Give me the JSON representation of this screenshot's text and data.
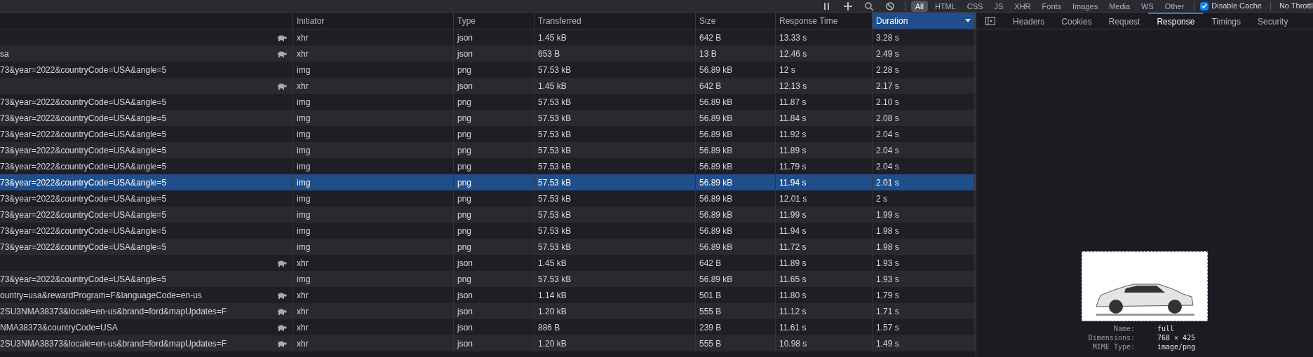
{
  "toolbar": {
    "filters": [
      {
        "label": "All",
        "selected": true
      },
      {
        "label": "HTML",
        "selected": false
      },
      {
        "label": "CSS",
        "selected": false
      },
      {
        "label": "JS",
        "selected": false
      },
      {
        "label": "XHR",
        "selected": false
      },
      {
        "label": "Fonts",
        "selected": false
      },
      {
        "label": "Images",
        "selected": false
      },
      {
        "label": "Media",
        "selected": false
      },
      {
        "label": "WS",
        "selected": false
      },
      {
        "label": "Other",
        "selected": false
      }
    ],
    "disable_cache": {
      "label": "Disable Cache",
      "checked": true
    },
    "throttling": "No Throttl"
  },
  "table": {
    "columns": [
      {
        "sorted": false
      },
      {
        "label": "Initiator",
        "sorted": false
      },
      {
        "label": "Type",
        "sorted": false
      },
      {
        "label": "Transferred",
        "sorted": false
      },
      {
        "label": "Size",
        "sorted": false
      },
      {
        "label": "Response Time",
        "sorted": false
      },
      {
        "label": "Duration",
        "sorted": true
      }
    ],
    "rows": [
      {
        "slow": true,
        "initiator": "xhr",
        "type": "json",
        "transferred": "1.45 kB",
        "size": "642 B",
        "response_time": "13.33 s",
        "duration": "3.28 s",
        "selected": false
      },
      {
        "name": "sa",
        "slow": true,
        "initiator": "xhr",
        "type": "json",
        "transferred": "653 B",
        "size": "13 B",
        "response_time": "12.46 s",
        "duration": "2.49 s",
        "selected": false
      },
      {
        "name": "73&year=2022&countryCode=USA&angle=5",
        "slow": false,
        "initiator": "img",
        "type": "png",
        "transferred": "57.53 kB",
        "size": "56.89 kB",
        "response_time": "12 s",
        "duration": "2.28 s",
        "selected": false
      },
      {
        "slow": true,
        "initiator": "xhr",
        "type": "json",
        "transferred": "1.45 kB",
        "size": "642 B",
        "response_time": "12.13 s",
        "duration": "2.17 s",
        "selected": false
      },
      {
        "name": "73&year=2022&countryCode=USA&angle=5",
        "slow": false,
        "initiator": "img",
        "type": "png",
        "transferred": "57.53 kB",
        "size": "56.89 kB",
        "response_time": "11.87 s",
        "duration": "2.10 s",
        "selected": false
      },
      {
        "name": "73&year=2022&countryCode=USA&angle=5",
        "slow": false,
        "initiator": "img",
        "type": "png",
        "transferred": "57.53 kB",
        "size": "56.89 kB",
        "response_time": "11.84 s",
        "duration": "2.08 s",
        "selected": false
      },
      {
        "name": "73&year=2022&countryCode=USA&angle=5",
        "slow": false,
        "initiator": "img",
        "type": "png",
        "transferred": "57.53 kB",
        "size": "56.89 kB",
        "response_time": "11.92 s",
        "duration": "2.04 s",
        "selected": false
      },
      {
        "name": "73&year=2022&countryCode=USA&angle=5",
        "slow": false,
        "initiator": "img",
        "type": "png",
        "transferred": "57.53 kB",
        "size": "56.89 kB",
        "response_time": "11.89 s",
        "duration": "2.04 s",
        "selected": false
      },
      {
        "name": "73&year=2022&countryCode=USA&angle=5",
        "slow": false,
        "initiator": "img",
        "type": "png",
        "transferred": "57.53 kB",
        "size": "56.89 kB",
        "response_time": "11.79 s",
        "duration": "2.04 s",
        "selected": false
      },
      {
        "name": "73&year=2022&countryCode=USA&angle=5",
        "slow": false,
        "initiator": "img",
        "type": "png",
        "transferred": "57.53 kB",
        "size": "56.89 kB",
        "response_time": "11.94 s",
        "duration": "2.01 s",
        "selected": true
      },
      {
        "name": "73&year=2022&countryCode=USA&angle=5",
        "slow": false,
        "initiator": "img",
        "type": "png",
        "transferred": "57.53 kB",
        "size": "56.89 kB",
        "response_time": "12.01 s",
        "duration": "2 s",
        "selected": false
      },
      {
        "name": "73&year=2022&countryCode=USA&angle=5",
        "slow": false,
        "initiator": "img",
        "type": "png",
        "transferred": "57.53 kB",
        "size": "56.89 kB",
        "response_time": "11.99 s",
        "duration": "1.99 s",
        "selected": false
      },
      {
        "name": "73&year=2022&countryCode=USA&angle=5",
        "slow": false,
        "initiator": "img",
        "type": "png",
        "transferred": "57.53 kB",
        "size": "56.89 kB",
        "response_time": "11.94 s",
        "duration": "1.98 s",
        "selected": false
      },
      {
        "name": "73&year=2022&countryCode=USA&angle=5",
        "slow": false,
        "initiator": "img",
        "type": "png",
        "transferred": "57.53 kB",
        "size": "56.89 kB",
        "response_time": "11.72 s",
        "duration": "1.98 s",
        "selected": false
      },
      {
        "slow": true,
        "initiator": "xhr",
        "type": "json",
        "transferred": "1.45 kB",
        "size": "642 B",
        "response_time": "11.89 s",
        "duration": "1.93 s",
        "selected": false
      },
      {
        "name": "73&year=2022&countryCode=USA&angle=5",
        "slow": false,
        "initiator": "img",
        "type": "png",
        "transferred": "57.53 kB",
        "size": "56.89 kB",
        "response_time": "11.65 s",
        "duration": "1.93 s",
        "selected": false
      },
      {
        "name": "ountry=usa&rewardProgram=F&languageCode=en-us",
        "slow": true,
        "initiator": "xhr",
        "type": "json",
        "transferred": "1.14 kB",
        "size": "501 B",
        "response_time": "11.80 s",
        "duration": "1.79 s",
        "selected": false
      },
      {
        "name": "2SU3NMA38373&locale=en-us&brand=ford&mapUpdates=F",
        "slow": true,
        "initiator": "xhr",
        "type": "json",
        "transferred": "1.20 kB",
        "size": "555 B",
        "response_time": "11.12 s",
        "duration": "1.71 s",
        "selected": false
      },
      {
        "name": "NMA38373&countryCode=USA",
        "slow": true,
        "initiator": "xhr",
        "type": "json",
        "transferred": "886 B",
        "size": "239 B",
        "response_time": "11.61 s",
        "duration": "1.57 s",
        "selected": false
      },
      {
        "name": "2SU3NMA38373&locale=en-us&brand=ford&mapUpdates=F",
        "slow": true,
        "initiator": "xhr",
        "type": "json",
        "transferred": "1.20 kB",
        "size": "555 B",
        "response_time": "10.98 s",
        "duration": "1.49 s",
        "selected": false
      }
    ]
  },
  "details": {
    "tabs": [
      {
        "label": "Headers",
        "selected": false
      },
      {
        "label": "Cookies",
        "selected": false
      },
      {
        "label": "Request",
        "selected": false
      },
      {
        "label": "Response",
        "selected": true
      },
      {
        "label": "Timings",
        "selected": false
      },
      {
        "label": "Security",
        "selected": false
      }
    ],
    "image_info": [
      {
        "label": "Name:",
        "value": "full"
      },
      {
        "label": "Dimensions:",
        "value": "768 × 425"
      },
      {
        "label": "MIME Type:",
        "value": "image/png"
      }
    ]
  }
}
